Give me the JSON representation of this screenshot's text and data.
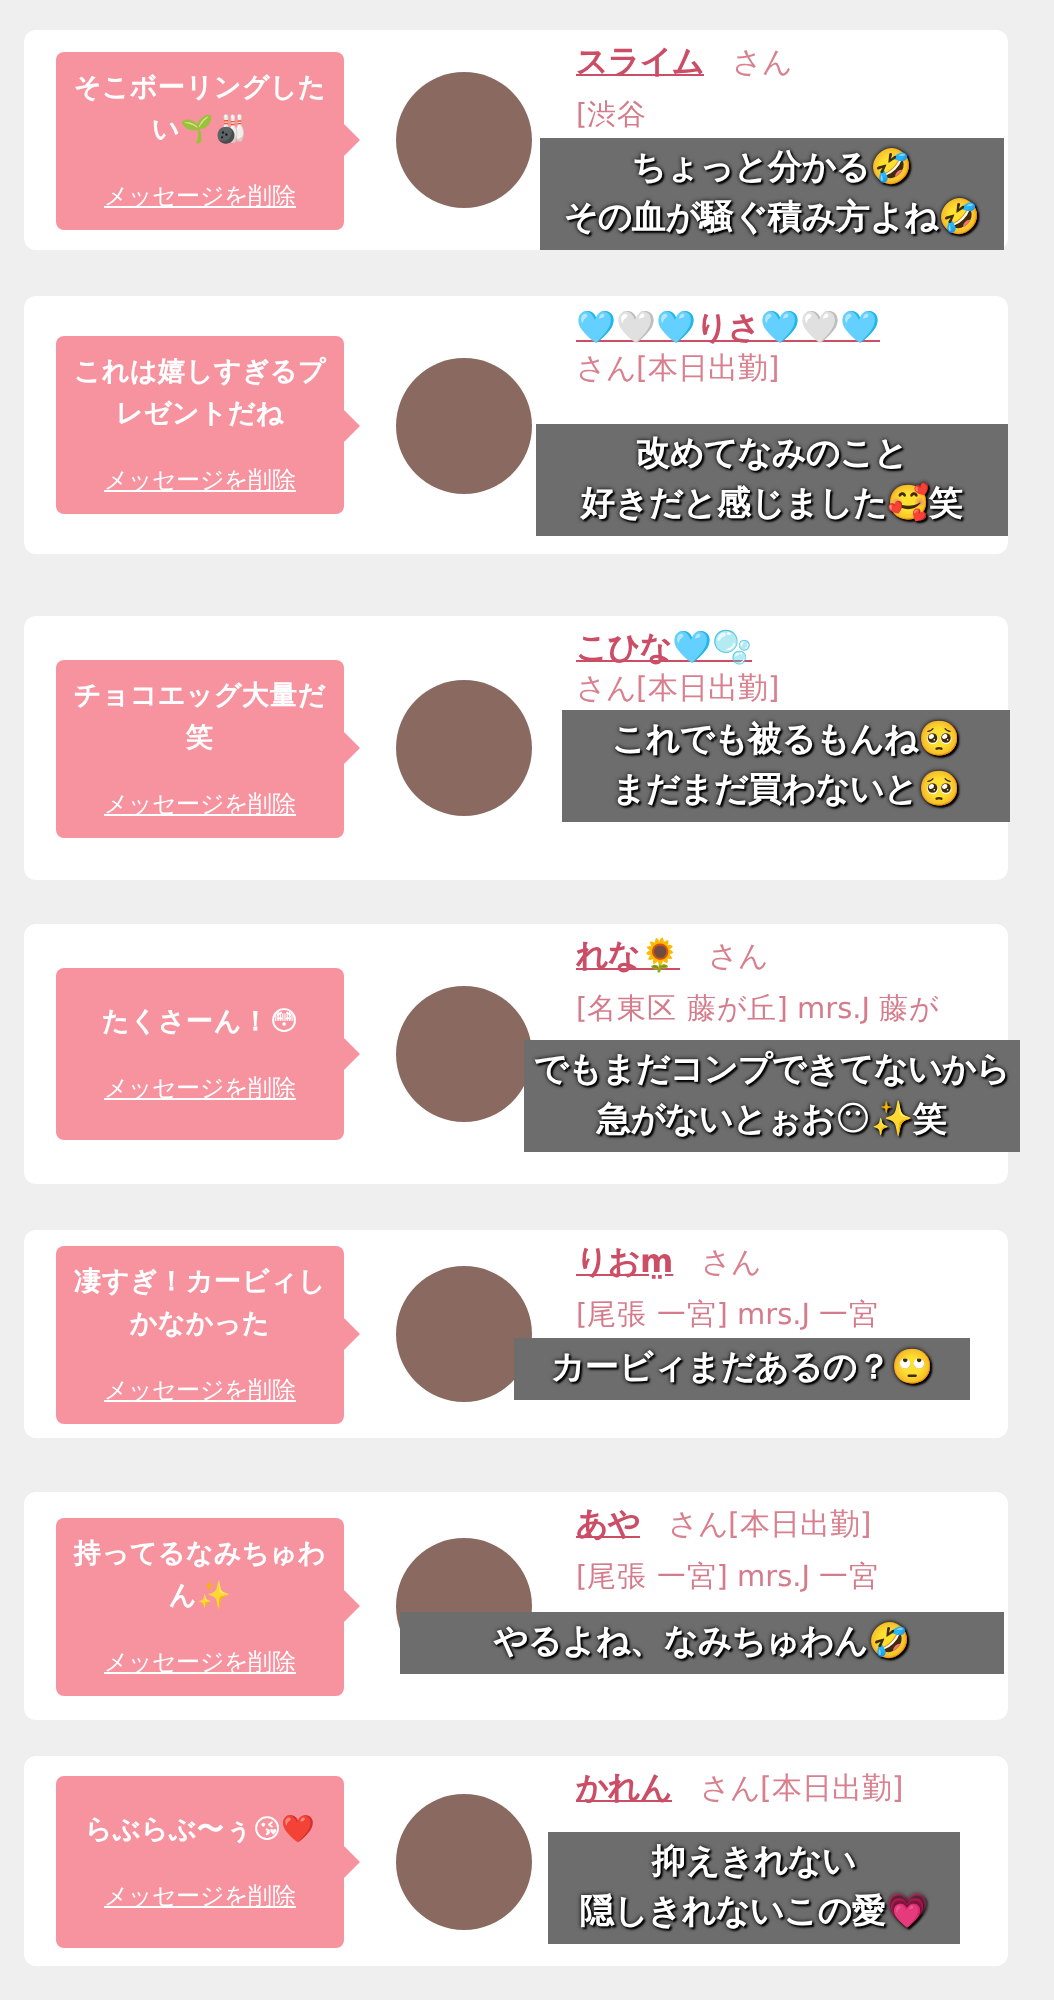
{
  "cards": [
    {
      "message": "そこボーリングしたい🌱🎳",
      "delete_link": "メッセージを削除",
      "name": "スライム",
      "honorific": "さん",
      "info_lines": [
        "[渋谷"
      ],
      "caption": [
        "ちょっと分かる🤣",
        "その血が騒ぐ積み方よね🤣"
      ]
    },
    {
      "message": "これは嬉しすぎるプレゼントだね",
      "delete_link": "メッセージを削除",
      "name": "🩵🤍🩵りさ🩵🤍🩵",
      "honorific": "さん[本日出勤]",
      "caption": [
        "改めてなみのこと",
        "好きだと感じました🥰笑"
      ]
    },
    {
      "message": "チョコエッグ大量だ笑",
      "delete_link": "メッセージを削除",
      "name": "こひな🩵🫧",
      "honorific": "さん[本日出勤]",
      "caption": [
        "これでも被るもんね🥺",
        "まだまだ買わないと🥺"
      ]
    },
    {
      "message": "たくさーん！😳",
      "delete_link": "メッセージを削除",
      "name": "れな🌻",
      "honorific": "さん",
      "info_lines": [
        "[名東区 藤が丘] mrs.J 藤が"
      ],
      "caption": [
        "でもまだコンプできてないから",
        "急がないとぉお😶✨笑"
      ]
    },
    {
      "message": "凄すぎ！カービィしかなかった",
      "delete_link": "メッセージを削除",
      "name": "りおm̤",
      "honorific": "さん",
      "info_lines": [
        "[尾張 一宮] mrs.J 一宮"
      ],
      "caption": [
        "カービィまだあるの？🙄"
      ]
    },
    {
      "message": "持ってるなみちゅわん✨",
      "delete_link": "メッセージを削除",
      "name": "あや",
      "honorific": "さん[本日出勤]",
      "info_lines": [
        "[尾張 一宮] mrs.J 一宮"
      ],
      "caption": [
        "やるよね、なみちゅわん🤣"
      ]
    },
    {
      "message": "らぶらぶ〜ぅ😘❤️",
      "delete_link": "メッセージを削除",
      "name": "かれん",
      "honorific": "さん[本日出勤]",
      "caption": [
        "抑えきれない",
        "隠しきれないこの愛💗"
      ]
    }
  ]
}
